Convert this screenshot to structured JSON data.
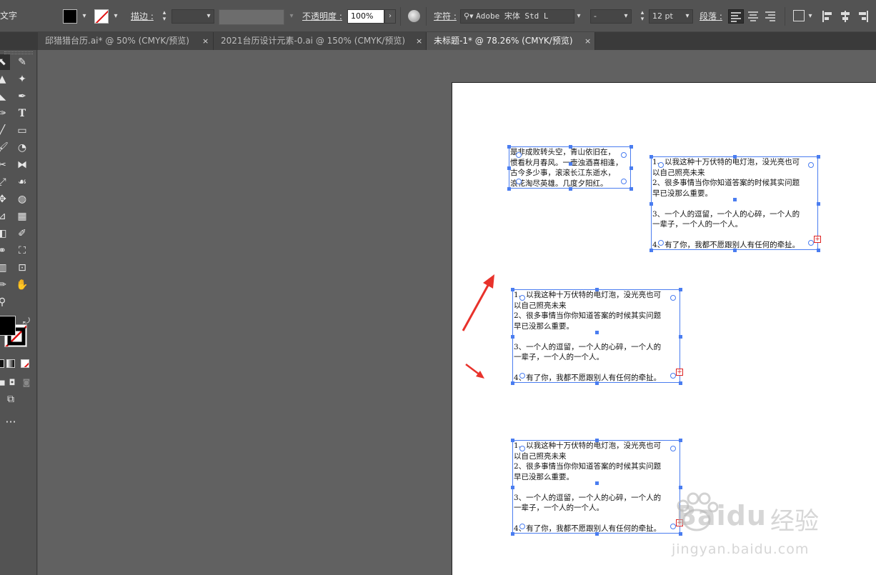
{
  "control_bar": {
    "type_label": "文字",
    "stroke_label": "描边 :",
    "opacity_label": "不透明度 :",
    "opacity_value": "100%",
    "character_label": "字符 :",
    "font_name": "Adobe 宋体 Std L",
    "font_style": "-",
    "font_size": "12 pt",
    "paragraph_label": "段落 :"
  },
  "tabs": [
    {
      "label": "邱猎猎台历.ai* @ 50% (CMYK/预览)",
      "close": "×"
    },
    {
      "label": "2021台历设计元素-0.ai @ 150% (CMYK/预览)",
      "close": "×"
    },
    {
      "label": "未标题-1* @ 78.26% (CMYK/预览)",
      "close": "×"
    }
  ],
  "text_frames": {
    "poem": [
      "是非成败转头空，青山依旧在，",
      "惯看秋月春风。一壶浊酒喜相逢，",
      "古今多少事，滚滚长江东逝水，",
      "浪花淘尽英雄。几度夕阳红。"
    ],
    "list": [
      "1、以我这种十万伏特的电灯泡，没光亮也可",
      "以自己照亮未来",
      "2、很多事情当你你知道答案的时候其实问题",
      "早已没那么重要。",
      "",
      "3、一个人的逗留，一个人的心碎，一个人的",
      "一辈子，一个人的一个人。",
      "",
      "4、有了你，我都不愿跟别人有任何的牵扯。"
    ]
  },
  "watermark": {
    "brand": "Baidu",
    "brand_cn": "经验",
    "url": "jingyan.baidu.com"
  },
  "colors": {
    "selection": "#4a7df0",
    "arrow": "#e8322b"
  }
}
